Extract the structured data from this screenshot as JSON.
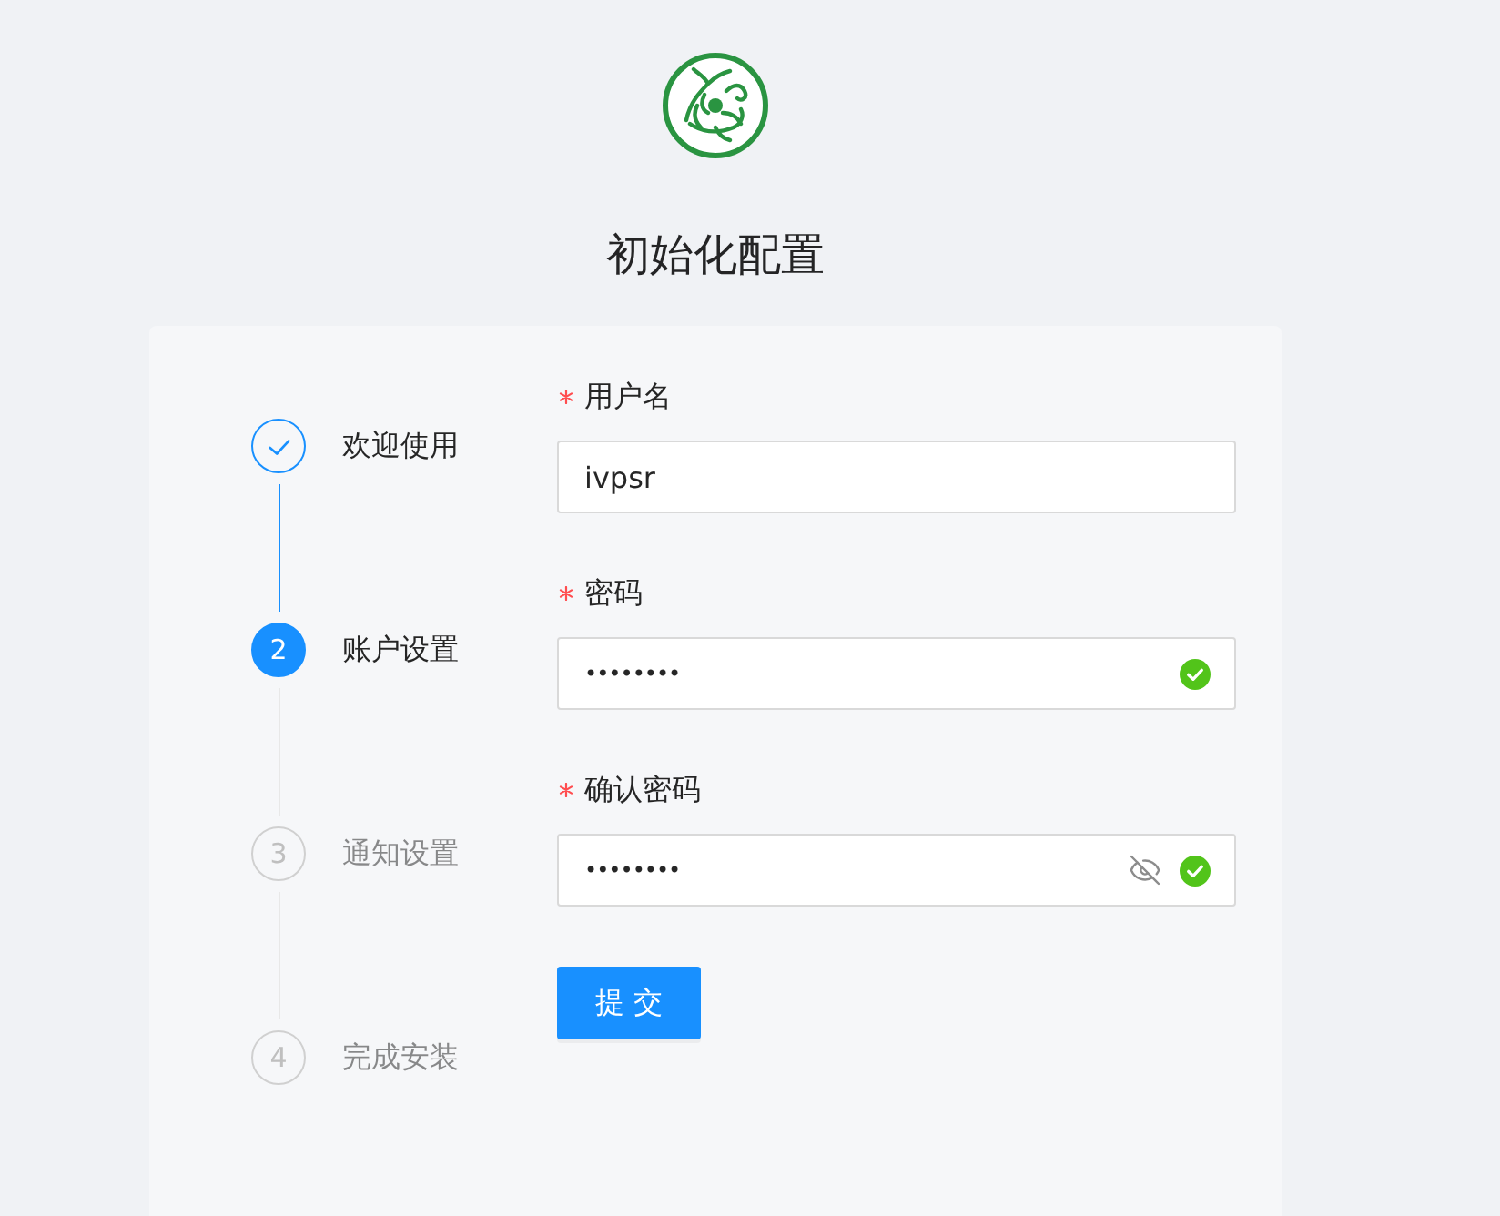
{
  "page": {
    "title": "初始化配置"
  },
  "steps": [
    {
      "title": "欢迎使用",
      "completed": true,
      "selected": false
    },
    {
      "number": "2",
      "title": "账户设置",
      "completed": false,
      "selected": true
    },
    {
      "number": "3",
      "title": "通知设置",
      "completed": false,
      "selected": false
    },
    {
      "number": "4",
      "title": "完成安装",
      "completed": false,
      "selected": false
    }
  ],
  "form": {
    "fields": [
      {
        "kind": "text",
        "label": "用户名",
        "required": true,
        "value": "ivpsr",
        "valid": false,
        "visibility_toggle": false
      },
      {
        "kind": "password",
        "label": "密码",
        "required": true,
        "value": "••••••••",
        "valid": true,
        "visibility_toggle": false
      },
      {
        "kind": "password",
        "label": "确认密码",
        "required": true,
        "value": "••••••••",
        "valid": true,
        "visibility_toggle": true
      }
    ],
    "submit_button": "提 交"
  }
}
